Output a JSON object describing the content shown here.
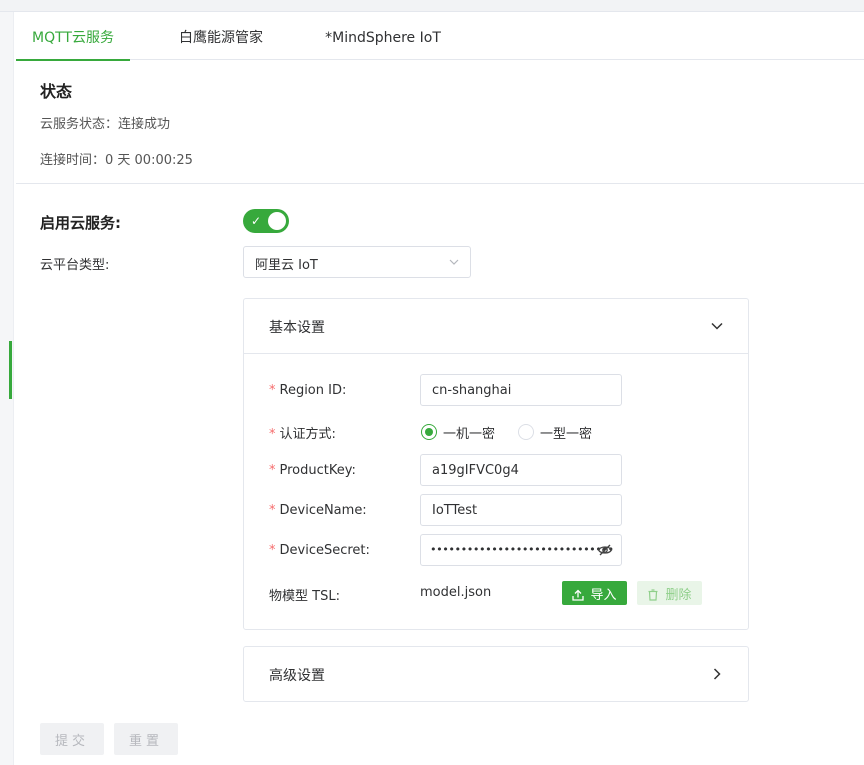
{
  "tabs": [
    {
      "label": "MQTT云服务",
      "active": true
    },
    {
      "label": "白鹰能源管家",
      "active": false
    },
    {
      "label": "*MindSphere IoT",
      "active": false
    }
  ],
  "status": {
    "title": "状态",
    "cloud_status": "云服务状态：连接成功",
    "connect_time": "连接时间：0 天 00:00:25"
  },
  "form": {
    "enable_label": "启用云服务:",
    "enable_on": true,
    "platform_label": "云平台类型:",
    "platform_value": "阿里云 IoT"
  },
  "basic": {
    "title": "基本设置",
    "region_label": "Region ID:",
    "region_value": "cn-shanghai",
    "auth_label": "认证方式:",
    "auth_options": [
      "一机一密",
      "一型一密"
    ],
    "auth_selected": "一机一密",
    "product_label": "ProductKey:",
    "product_value": "a19gIFVC0g4",
    "device_name_label": "DeviceName:",
    "device_name_value": "IoTTest",
    "device_secret_label": "DeviceSecret:",
    "device_secret_mask": "••••••••••••••••••••••••••••••",
    "tsl_label": "物模型 TSL:",
    "tsl_file": "model.json",
    "import_label": "导入",
    "delete_label": "删除",
    "required_mark": "*"
  },
  "advanced": {
    "title": "高级设置"
  },
  "footer": {
    "submit_label": "提交",
    "reset_label": "重置"
  },
  "colors": {
    "accent": "#37a93c",
    "required": "#f56c6c",
    "border": "#dcdfe6"
  },
  "icons": {
    "select_arrow": "chevron-down-icon",
    "basic_arrow": "chevron-down-icon",
    "advanced_arrow": "chevron-right-icon",
    "password_toggle": "eye-off-icon",
    "import": "upload-icon",
    "delete": "trash-icon"
  }
}
